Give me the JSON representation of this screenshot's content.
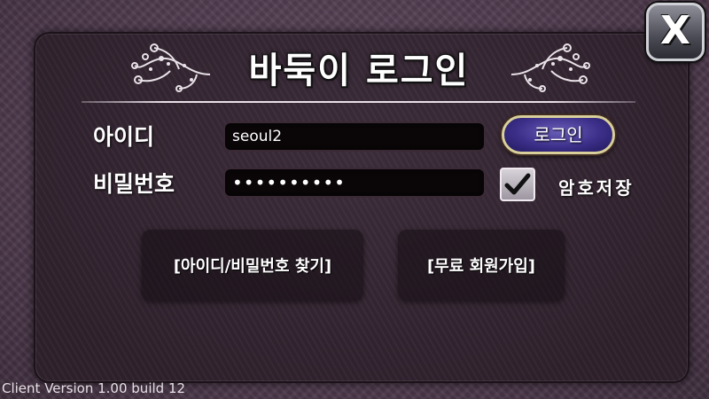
{
  "dialog": {
    "title": "바둑이 로그인",
    "close_label": "X"
  },
  "form": {
    "id_label": "아이디",
    "id_value": "seoul2",
    "password_label": "비밀번호",
    "password_value": "••••••••••",
    "login_button": "로그인",
    "save_password_label": "암호저장",
    "save_password_checked": true
  },
  "actions": {
    "find_account": "[아이디/비밀번호 찾기]",
    "signup": "[무료 회원가입]"
  },
  "footer": {
    "version": "Client Version 1.00 build 12"
  },
  "colors": {
    "accent_login": "#3c2f8a",
    "panel_bg": "#2f222d",
    "background": "#4a3749"
  }
}
